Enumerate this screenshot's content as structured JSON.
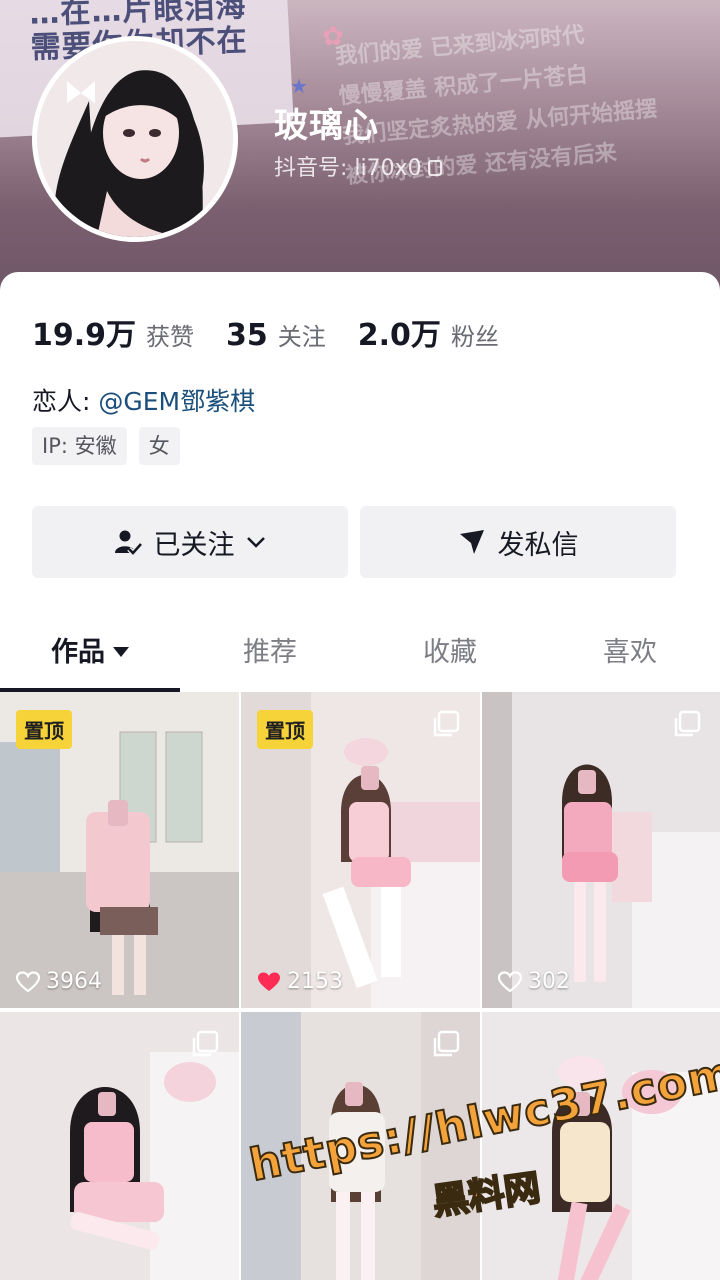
{
  "header": {
    "paper_text_line1": "…在…片眼泪海",
    "paper_text_line2": "需要你你却不在",
    "bg_line1": "我们的爱 已来到冰河时代",
    "bg_line2": "慢慢覆盖 积成了一片苍白",
    "bg_line3": "我们坚定炙热的爱 从何开始摇摆",
    "bg_line4": "被你冰封的爱 还有没有后来",
    "nickname": "玻璃心",
    "douyin_id": "抖音号: li70x0"
  },
  "stats": [
    {
      "value": "19.9万",
      "label": "获赞"
    },
    {
      "value": "35",
      "label": "关注"
    },
    {
      "value": "2.0万",
      "label": "粉丝"
    }
  ],
  "bio": {
    "prefix": "恋人: ",
    "mention": "@GEM鄧紫棋"
  },
  "tags": [
    "IP: 安徽",
    "女"
  ],
  "actions": {
    "follow_label": "已关注",
    "message_label": "发私信"
  },
  "tabs": [
    "作品",
    "推荐",
    "收藏",
    "喜欢"
  ],
  "videos": [
    {
      "pinned": "置顶",
      "likes": "3964",
      "liked": false
    },
    {
      "pinned": "置顶",
      "likes": "2153",
      "liked": true
    },
    {
      "pinned": "",
      "likes": "302",
      "liked": false
    },
    {
      "pinned": "",
      "likes": "",
      "liked": false
    },
    {
      "pinned": "",
      "likes": "",
      "liked": false
    },
    {
      "pinned": "",
      "likes": "",
      "liked": false
    }
  ],
  "watermark": {
    "url": "https://hlwc37.com",
    "site": "黑料网"
  },
  "colors": {
    "accent_like": "#fe2c55",
    "pin_badge": "#f7d33a",
    "mention": "#1b4f7b"
  }
}
